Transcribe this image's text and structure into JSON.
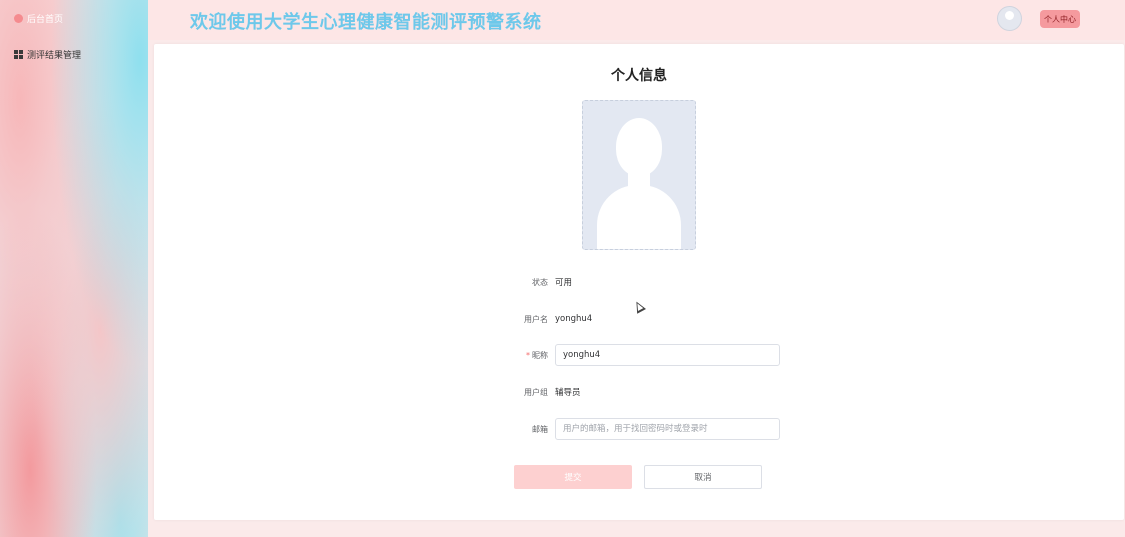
{
  "sidebar": {
    "items": [
      {
        "label": "后台首页",
        "icon": "home-icon"
      },
      {
        "label": "测评结果管理",
        "icon": "grid-icon"
      }
    ]
  },
  "header": {
    "title": "欢迎使用大学生心理健康智能测评预警系统",
    "user_center_label": "个人中心",
    "avatar_icon": "avatar-icon"
  },
  "main": {
    "page_title": "个人信息",
    "photo_icon": "user-silhouette-icon",
    "fields": {
      "status": {
        "label": "状态",
        "value": "可用"
      },
      "username": {
        "label": "用户名",
        "value": "yonghu4"
      },
      "nickname": {
        "required_mark": "*",
        "label": "昵称",
        "value": "yonghu4"
      },
      "user_group": {
        "label": "用户组",
        "value": "辅导员"
      },
      "email": {
        "label": "邮箱",
        "value": "",
        "placeholder": "用户的邮箱，用于找回密码时或登录时"
      }
    },
    "submit_label": "提交",
    "cancel_label": "取消"
  },
  "colors": {
    "accent": "#6ec8ea",
    "header_bg": "#fde6e6",
    "button_pink": "#f59a9e",
    "submit_bg": "#fdd0d0",
    "required": "#f56c6c"
  }
}
